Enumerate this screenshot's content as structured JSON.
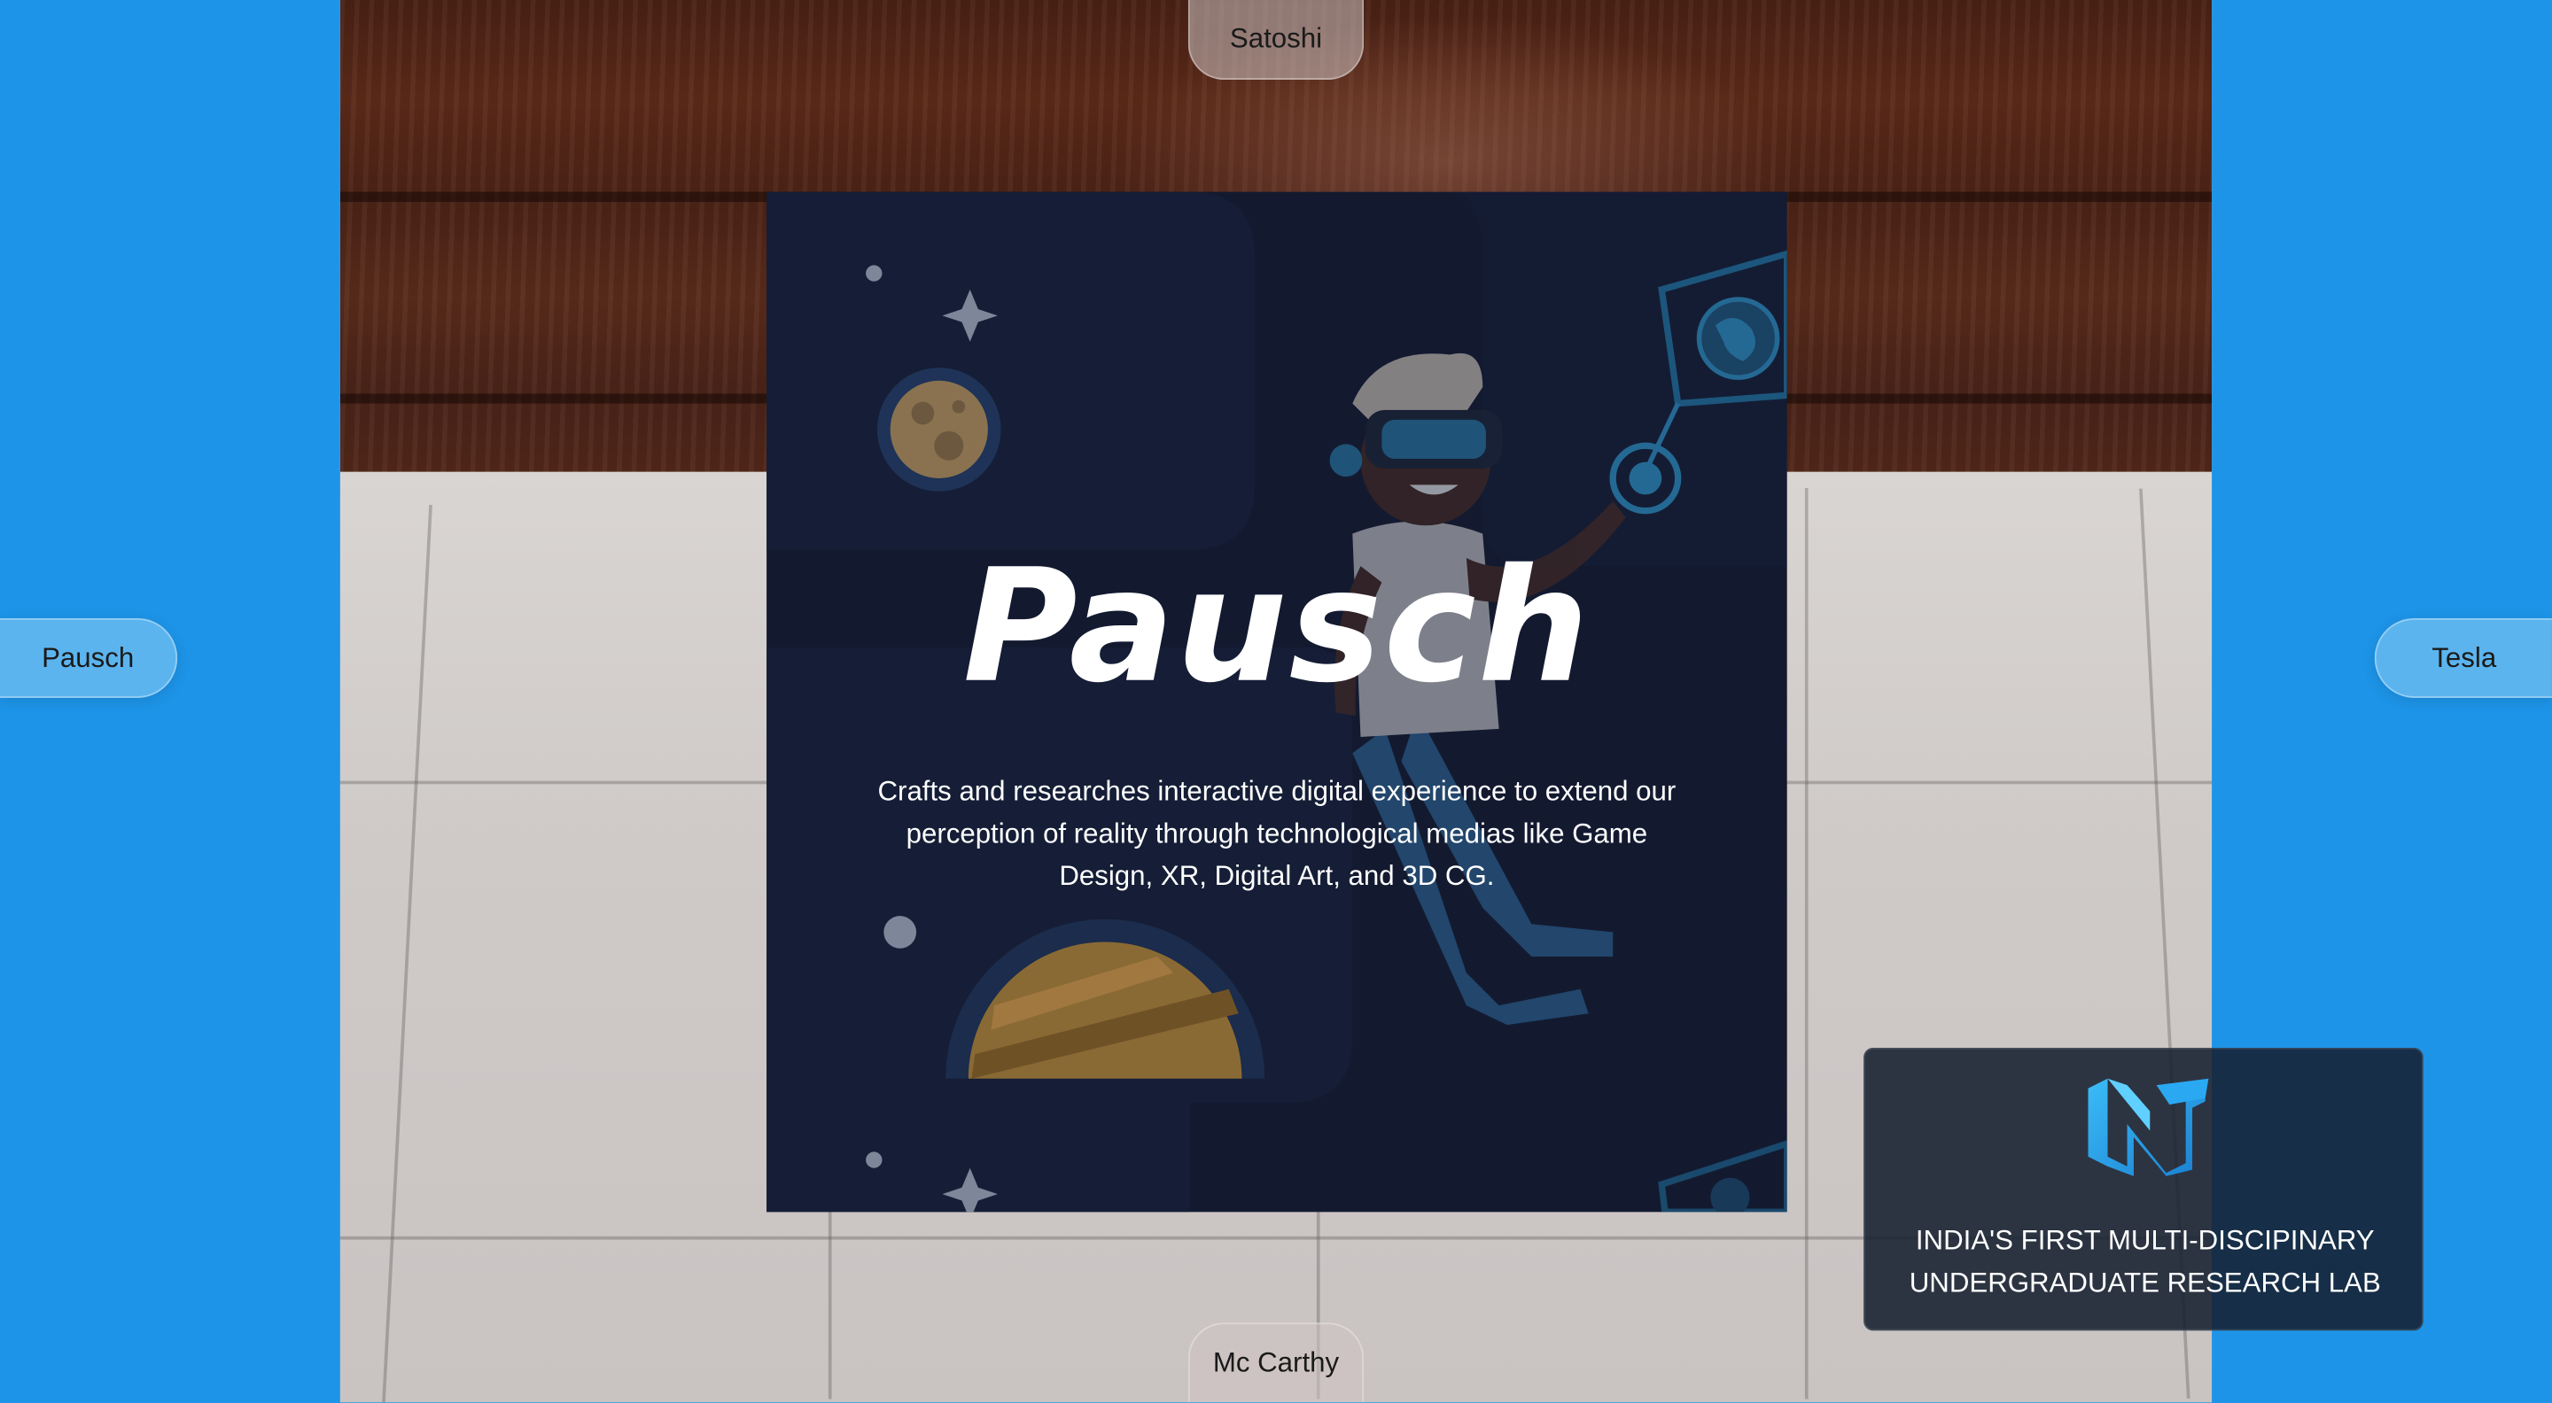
{
  "nav": {
    "top_label": "Satoshi",
    "bottom_label": "Mc Carthy",
    "left_label": "Pausch",
    "right_label": "Tesla"
  },
  "card": {
    "title": "Pausch",
    "description": "Crafts and researches interactive digital experience to extend our perception of reality through technological medias like Game Design, XR, Digital Art, and 3D CG."
  },
  "lab_panel": {
    "tagline_line1": "INDIA'S FIRST MULTI-DISCIPINARY",
    "tagline_line2": "UNDERGRADUATE RESEARCH LAB",
    "logo_icon": "nt-logo-icon"
  },
  "colors": {
    "page_background": "#1d94e8",
    "card_background": "#131a30",
    "side_tab_background": "#5cb4ee",
    "logo_accent": "#2aa8f2"
  }
}
